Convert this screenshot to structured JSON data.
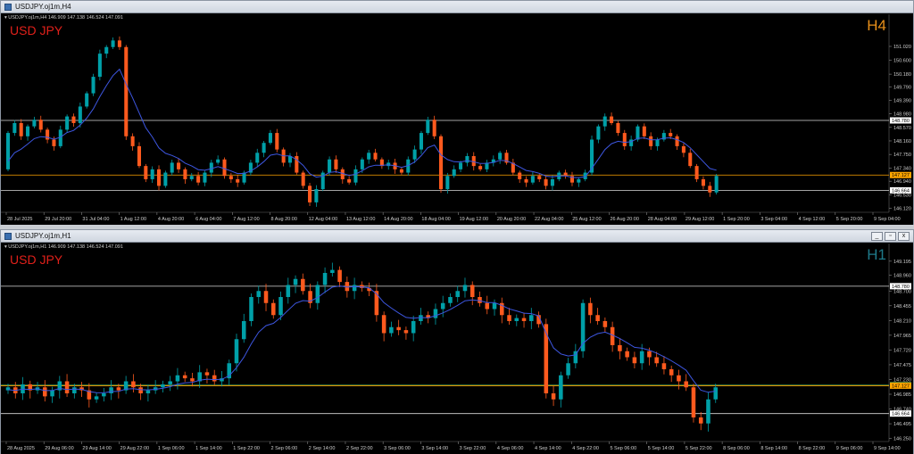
{
  "colors": {
    "bull": "#00a0a8",
    "bear": "#ff5a1e",
    "ma": "#3d56e0",
    "line": "#d8d8d8",
    "bid": "#ffa500",
    "ask": "#3a8a4a",
    "label_red": "#e0201a",
    "tf_h4": "#e8901a",
    "tf_h1": "#1f7a8a"
  },
  "windows": [
    {
      "title": "USDJPY.oj1m,H4",
      "ohlc": "▾ USDJPY.oj1m,H4  146.909 147.138 146.524 147.091",
      "symbol_label": "USD JPY",
      "timeframe": "H4",
      "buttons": [],
      "price_min": 146.0,
      "price_max": 151.83,
      "price_ticks": [
        "151.020",
        "150.600",
        "150.180",
        "149.790",
        "149.390",
        "148.980",
        "148.570",
        "148.160",
        "147.750",
        "147.340",
        "146.940",
        "146.530",
        "146.120"
      ],
      "tick_values": [
        151.02,
        150.6,
        150.18,
        149.79,
        149.39,
        148.98,
        148.57,
        148.16,
        147.75,
        147.34,
        146.94,
        146.53,
        146.12
      ],
      "hlines": [
        {
          "price": 148.78,
          "label": "148.780",
          "kind": "line"
        },
        {
          "price": 147.127,
          "label": "147.127",
          "kind": "bid"
        },
        {
          "price": 146.664,
          "label": "146.664",
          "kind": "line"
        }
      ],
      "time_labels": [
        "28 Jul 2025",
        "29 Jul 20:00",
        "31 Jul 04:00",
        "1 Aug 12:00",
        "4 Aug 20:00",
        "6 Aug 04:00",
        "7 Aug 12:00",
        "8 Aug 20:00",
        "12 Aug 04:00",
        "13 Aug 12:00",
        "14 Aug 20:00",
        "18 Aug 04:00",
        "19 Aug 12:00",
        "20 Aug 20:00",
        "22 Aug 04:00",
        "25 Aug 12:00",
        "26 Aug 20:00",
        "28 Aug 04:00",
        "29 Aug 12:00",
        "1 Sep 20:00",
        "3 Sep 04:00",
        "4 Sep 12:00",
        "5 Sep 20:00",
        "9 Sep 04:00"
      ],
      "closes": [
        148.4,
        148.7,
        148.3,
        148.6,
        148.8,
        148.5,
        148.2,
        148.0,
        148.5,
        148.9,
        148.7,
        149.2,
        149.6,
        150.1,
        150.8,
        151.0,
        151.2,
        151.0,
        148.3,
        148.0,
        147.4,
        147.0,
        147.3,
        146.8,
        147.2,
        147.5,
        147.3,
        147.0,
        147.1,
        146.9,
        147.2,
        147.5,
        147.6,
        147.1,
        147.0,
        146.9,
        147.2,
        147.5,
        147.8,
        148.1,
        148.4,
        147.9,
        147.5,
        147.7,
        147.2,
        146.8,
        146.3,
        146.7,
        147.2,
        147.6,
        147.3,
        147.0,
        146.9,
        147.3,
        147.6,
        147.8,
        147.6,
        147.4,
        147.5,
        147.3,
        147.2,
        147.6,
        147.9,
        148.4,
        148.8,
        148.3,
        146.7,
        147.1,
        147.3,
        147.5,
        147.7,
        147.4,
        147.3,
        147.5,
        147.6,
        147.8,
        147.5,
        147.2,
        147.0,
        146.9,
        147.1,
        147.0,
        146.8,
        147.0,
        147.2,
        147.1,
        146.9,
        147.0,
        147.2,
        148.2,
        148.6,
        148.9,
        148.7,
        148.4,
        148.0,
        148.2,
        148.6,
        148.3,
        148.0,
        148.2,
        148.4,
        148.3,
        148.0,
        147.8,
        147.4,
        147.0,
        146.8,
        146.6,
        147.1
      ],
      "ma_start": 147.3
    },
    {
      "title": "USDJPY.oj1m,H1",
      "ohlc": "▾ USDJPY.oj1m,H1  146.909 147.138 146.524 147.091",
      "symbol_label": "USD JPY",
      "timeframe": "H1",
      "buttons": [
        "_",
        "▫",
        "x"
      ],
      "price_min": 146.2,
      "price_max": 149.4,
      "price_ticks": [
        "149.195",
        "148.960",
        "148.700",
        "148.455",
        "148.210",
        "147.965",
        "147.720",
        "147.475",
        "147.230",
        "146.985",
        "146.740",
        "146.495",
        "146.250"
      ],
      "tick_values": [
        149.195,
        148.96,
        148.7,
        148.455,
        148.21,
        147.965,
        147.72,
        147.475,
        147.23,
        146.985,
        146.74,
        146.495,
        146.25
      ],
      "hlines": [
        {
          "price": 148.78,
          "label": "148.780",
          "kind": "line"
        },
        {
          "price": 147.138,
          "label": "147.138",
          "kind": "ask"
        },
        {
          "price": 147.127,
          "label": "147.127",
          "kind": "bid"
        },
        {
          "price": 146.664,
          "label": "146.664",
          "kind": "line"
        }
      ],
      "time_labels": [
        "28 Aug 2025",
        "29 Aug 06:00",
        "29 Aug 14:00",
        "29 Aug 22:00",
        "1 Sep 06:00",
        "1 Sep 14:00",
        "1 Sep 22:00",
        "2 Sep 06:00",
        "2 Sep 14:00",
        "2 Sep 22:00",
        "3 Sep 06:00",
        "3 Sep 14:00",
        "3 Sep 22:00",
        "4 Sep 06:00",
        "4 Sep 14:00",
        "4 Sep 22:00",
        "5 Sep 06:00",
        "5 Sep 14:00",
        "5 Sep 22:00",
        "8 Sep 06:00",
        "8 Sep 14:00",
        "8 Sep 22:00",
        "9 Sep 06:00",
        "9 Sep 14:00"
      ],
      "closes": [
        147.1,
        147.0,
        147.15,
        147.05,
        147.1,
        146.95,
        147.05,
        147.2,
        147.0,
        147.1,
        147.05,
        146.9,
        146.95,
        147.0,
        147.1,
        147.05,
        147.2,
        147.1,
        147.0,
        147.05,
        147.1,
        147.15,
        147.2,
        147.3,
        147.25,
        147.2,
        147.35,
        147.3,
        147.2,
        147.25,
        147.5,
        147.9,
        148.2,
        148.6,
        148.7,
        148.5,
        148.3,
        148.6,
        148.8,
        148.9,
        148.7,
        148.5,
        148.8,
        149.0,
        149.05,
        148.85,
        148.7,
        148.8,
        148.75,
        148.7,
        148.3,
        148.0,
        148.1,
        148.05,
        148.0,
        148.2,
        148.3,
        148.25,
        148.4,
        148.5,
        148.6,
        148.7,
        148.8,
        148.6,
        148.5,
        148.4,
        148.5,
        148.3,
        148.2,
        148.25,
        148.2,
        148.3,
        148.15,
        147.0,
        146.9,
        147.3,
        147.5,
        147.7,
        148.5,
        148.3,
        148.2,
        148.1,
        147.8,
        147.7,
        147.6,
        147.5,
        147.7,
        147.6,
        147.5,
        147.4,
        147.3,
        147.2,
        147.1,
        146.6,
        146.5,
        146.9,
        147.1
      ],
      "ma_start": 147.05
    }
  ]
}
